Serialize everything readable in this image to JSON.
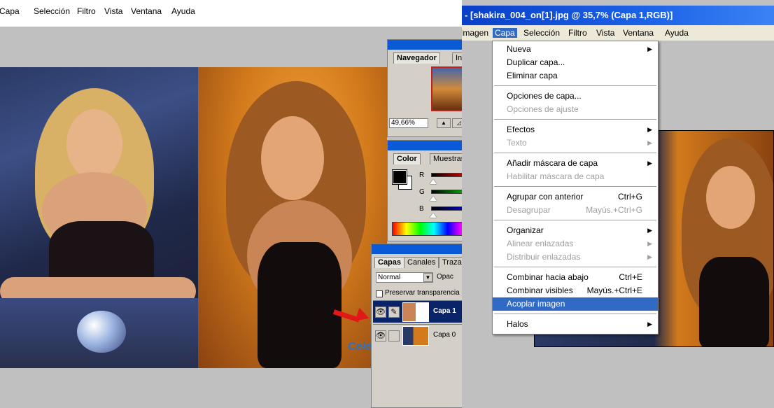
{
  "left_window": {
    "menu": [
      "Capa",
      "Selección",
      "Filtro",
      "Vista",
      "Ventana",
      "Ayuda"
    ],
    "watermark": "Cele"
  },
  "navigator_palette": {
    "tabs": [
      "Navegador",
      "Info"
    ],
    "zoom_value": "49,66%",
    "zoom_out_icon": "mountain-small-icon",
    "zoom_in_icon": "mountain-large-icon"
  },
  "color_palette": {
    "tabs": [
      "Color",
      "Muestras"
    ],
    "sliders": [
      {
        "label": "R",
        "color": "#cc0000"
      },
      {
        "label": "G",
        "color": "#00aa00"
      },
      {
        "label": "B",
        "color": "#0000cc"
      }
    ]
  },
  "layers_palette": {
    "tabs": [
      "Capas",
      "Canales",
      "Trazados"
    ],
    "blend_mode": "Normal",
    "opacity_label": "Opac",
    "preserve_label": "Preservar transparencia",
    "layers": [
      {
        "name": "Capa 1",
        "selected": true,
        "visible": true
      },
      {
        "name": "Capa 0",
        "selected": false,
        "visible": true
      }
    ]
  },
  "right_window": {
    "title": "- [shakira_004_on[1].jpg @ 35,7% (Capa 1,RGB)]",
    "menu": [
      "Imagen",
      "Capa",
      "Selección",
      "Filtro",
      "Vista",
      "Ventana",
      "Ayuda"
    ],
    "open_menu": "Capa"
  },
  "capa_menu": {
    "groups": [
      [
        {
          "label": "Nueva",
          "submenu": true,
          "enabled": true
        },
        {
          "label": "Duplicar capa...",
          "enabled": true
        },
        {
          "label": "Eliminar capa",
          "enabled": true
        }
      ],
      [
        {
          "label": "Opciones de capa...",
          "enabled": true
        },
        {
          "label": "Opciones de ajuste",
          "enabled": false
        }
      ],
      [
        {
          "label": "Efectos",
          "submenu": true,
          "enabled": true
        },
        {
          "label": "Texto",
          "submenu": true,
          "enabled": false
        }
      ],
      [
        {
          "label": "Añadir máscara de capa",
          "submenu": true,
          "enabled": true
        },
        {
          "label": "Habilitar máscara de capa",
          "enabled": false
        }
      ],
      [
        {
          "label": "Agrupar con anterior",
          "shortcut": "Ctrl+G",
          "enabled": true
        },
        {
          "label": "Desagrupar",
          "shortcut": "Mayús.+Ctrl+G",
          "enabled": false
        }
      ],
      [
        {
          "label": "Organizar",
          "submenu": true,
          "enabled": true
        },
        {
          "label": "Alinear enlazadas",
          "submenu": true,
          "enabled": false
        },
        {
          "label": "Distribuir enlazadas",
          "submenu": true,
          "enabled": false
        }
      ],
      [
        {
          "label": "Combinar hacia abajo",
          "shortcut": "Ctrl+E",
          "enabled": true
        },
        {
          "label": "Combinar visibles",
          "shortcut": "Mayús.+Ctrl+E",
          "enabled": true
        },
        {
          "label": "Acoplar imagen",
          "enabled": true,
          "highlighted": true
        }
      ],
      [
        {
          "label": "Halos",
          "submenu": true,
          "enabled": true
        }
      ]
    ]
  },
  "colors": {
    "title_blue": "#0a5ad8",
    "menu_highlight": "#316ac5",
    "arrow_red": "#e01818"
  }
}
